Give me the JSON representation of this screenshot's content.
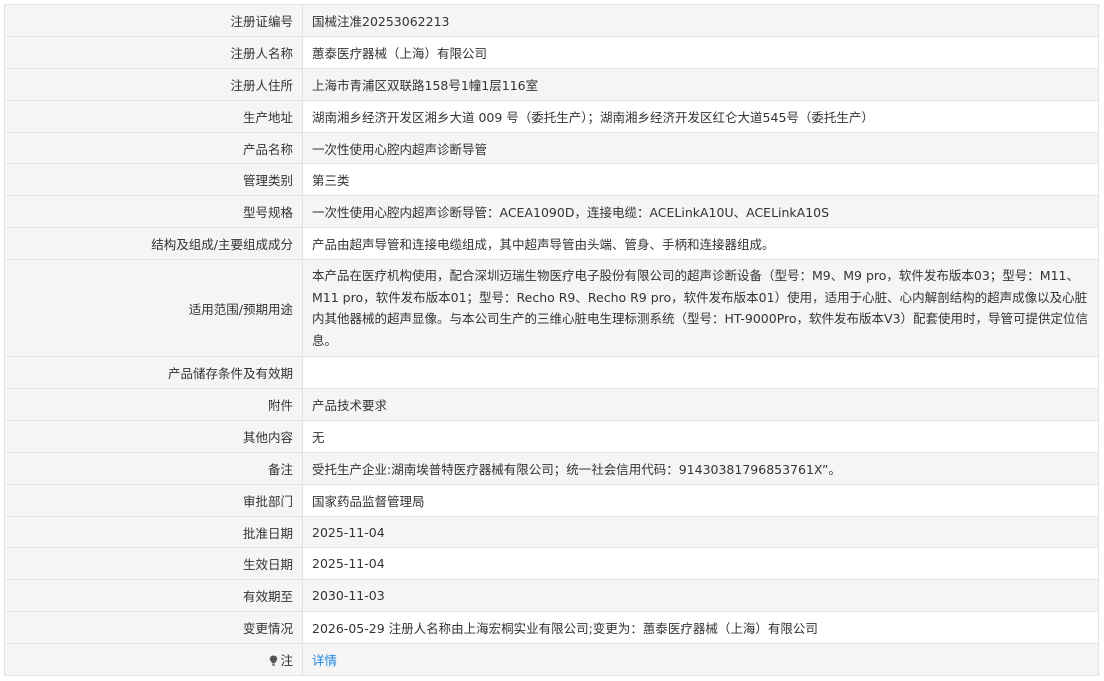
{
  "colors": {
    "label_bg": "#f5f5f5",
    "border": "#e3e3e3",
    "text": "#333333",
    "link": "#1e88e5"
  },
  "rows": [
    {
      "label": "注册证编号",
      "value": "国械注准20253062213"
    },
    {
      "label": "注册人名称",
      "value": "蕙泰医疗器械（上海）有限公司"
    },
    {
      "label": "注册人住所",
      "value": "上海市青浦区双联路158号1幢1层116室"
    },
    {
      "label": "生产地址",
      "value": "湖南湘乡经济开发区湘乡大道 009 号（委托生产）；湖南湘乡经济开发区红仑大道545号（委托生产）"
    },
    {
      "label": "产品名称",
      "value": "一次性使用心腔内超声诊断导管"
    },
    {
      "label": "管理类别",
      "value": "第三类"
    },
    {
      "label": "型号规格",
      "value": "一次性使用心腔内超声诊断导管：ACEA1090D，连接电缆：ACELinkA10U、ACELinkA10S"
    },
    {
      "label": "结构及组成/主要组成成分",
      "value": "产品由超声导管和连接电缆组成，其中超声导管由头端、管身、手柄和连接器组成。"
    },
    {
      "label": "适用范围/预期用途",
      "value": "本产品在医疗机构使用，配合深圳迈瑞生物医疗电子股份有限公司的超声诊断设备（型号：M9、M9 pro，软件发布版本03；型号：M11、M11 pro，软件发布版本01；型号：Recho R9、Recho R9 pro，软件发布版本01）使用，适用于心脏、心内解剖结构的超声成像以及心脏内其他器械的超声显像。与本公司生产的三维心脏电生理标测系统（型号：HT-9000Pro，软件发布版本V3）配套使用时，导管可提供定位信息。"
    },
    {
      "label": "产品储存条件及有效期",
      "value": ""
    },
    {
      "label": "附件",
      "value": "产品技术要求"
    },
    {
      "label": "其他内容",
      "value": "无"
    },
    {
      "label": "备注",
      "value": "受托生产企业:湖南埃普特医疗器械有限公司；统一社会信用代码：91430381796853761X”。"
    },
    {
      "label": "审批部门",
      "value": "国家药品监督管理局"
    },
    {
      "label": "批准日期",
      "value": "2025-11-04"
    },
    {
      "label": "生效日期",
      "value": "2025-11-04"
    },
    {
      "label": "有效期至",
      "value": "2030-11-03"
    },
    {
      "label": "变更情况",
      "value": "2026-05-29 注册人名称由上海宏桐实业有限公司;变更为：蕙泰医疗器械（上海）有限公司"
    }
  ],
  "note_row": {
    "label": "注",
    "link_text": "详情",
    "icon": "lightbulb-icon"
  }
}
